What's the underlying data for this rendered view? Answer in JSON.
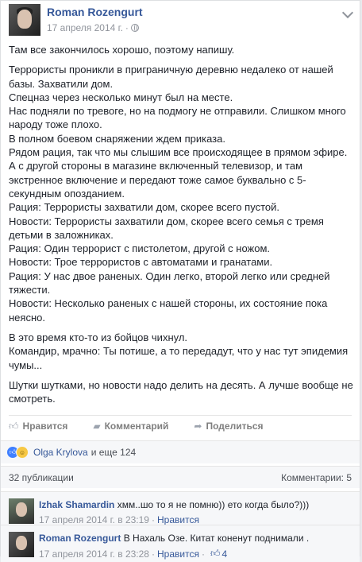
{
  "post": {
    "author": "Roman Rozengurt",
    "date": "17 апреля 2014 г.",
    "paragraphs": [
      "Там все закончилось хорошо, поэтому напишу.",
      "Террористы проникли в приграничную деревню недалеко от нашей базы. Захватили дом.\nСпецназ через несколько минут был на месте.\nНас подняли по тревоге, но на подмогу не отправили. Слишком много народу тоже плохо.\nВ полном боевом снаряжении ждем приказа.\nРядом рация, так что мы слышим все происходящее в прямом эфире.\nА с другой стороны в магазине включенный телевизор, и там экстренное включение и передают тоже самое буквально с 5-секундным опозданием.\nРация: Террористы захватили дом, скорее всего пустой.\nНовости: Террористы захватили дом, скорее всего семья с тремя детьми в заложниках.\nРация: Один террорист с пистолетом, другой с ножом.\nНовости: Трое террористов с автоматами и гранатами.\nРация: У нас двое раненых. Один легко, второй легко или средней тяжести.\nНовости: Несколько раненых с нашей стороны, их состояние пока неясно.",
      "В это время кто-то из бойцов чихнул.\nКомандир, мрачно: Ты потише, а то передадут, что у нас тут эпидемия чумы...",
      "Шутки шутками, но новости надо делить на десять. А лучше вообще не смотреть."
    ]
  },
  "actions": {
    "like": "Нравится",
    "comment": "Комментарий",
    "share": "Поделиться"
  },
  "likes": {
    "name": "Olga Krylova",
    "rest": "и еще 124"
  },
  "stats": {
    "shares": "32 публикации",
    "comments": "Комментарии: 5"
  },
  "comments": [
    {
      "name": "Izhak Shamardin",
      "text": "хмм..шо то я не помню)) ето когда было?)))",
      "time": "17 апреля 2014 г. в 23:19",
      "like_label": "Нравится",
      "likes": ""
    },
    {
      "name": "Roman Rozengurt",
      "text": "В Нахаль Озе. Китат коненут поднимали .",
      "time": "17 апреля 2014 г. в 23:28",
      "like_label": "Нравится",
      "likes": "4"
    }
  ],
  "icons": {
    "like": "thumbs-up-icon",
    "comment": "comment-icon",
    "share": "share-icon",
    "audience": "globe-icon",
    "menu": "chevron-down-icon"
  }
}
